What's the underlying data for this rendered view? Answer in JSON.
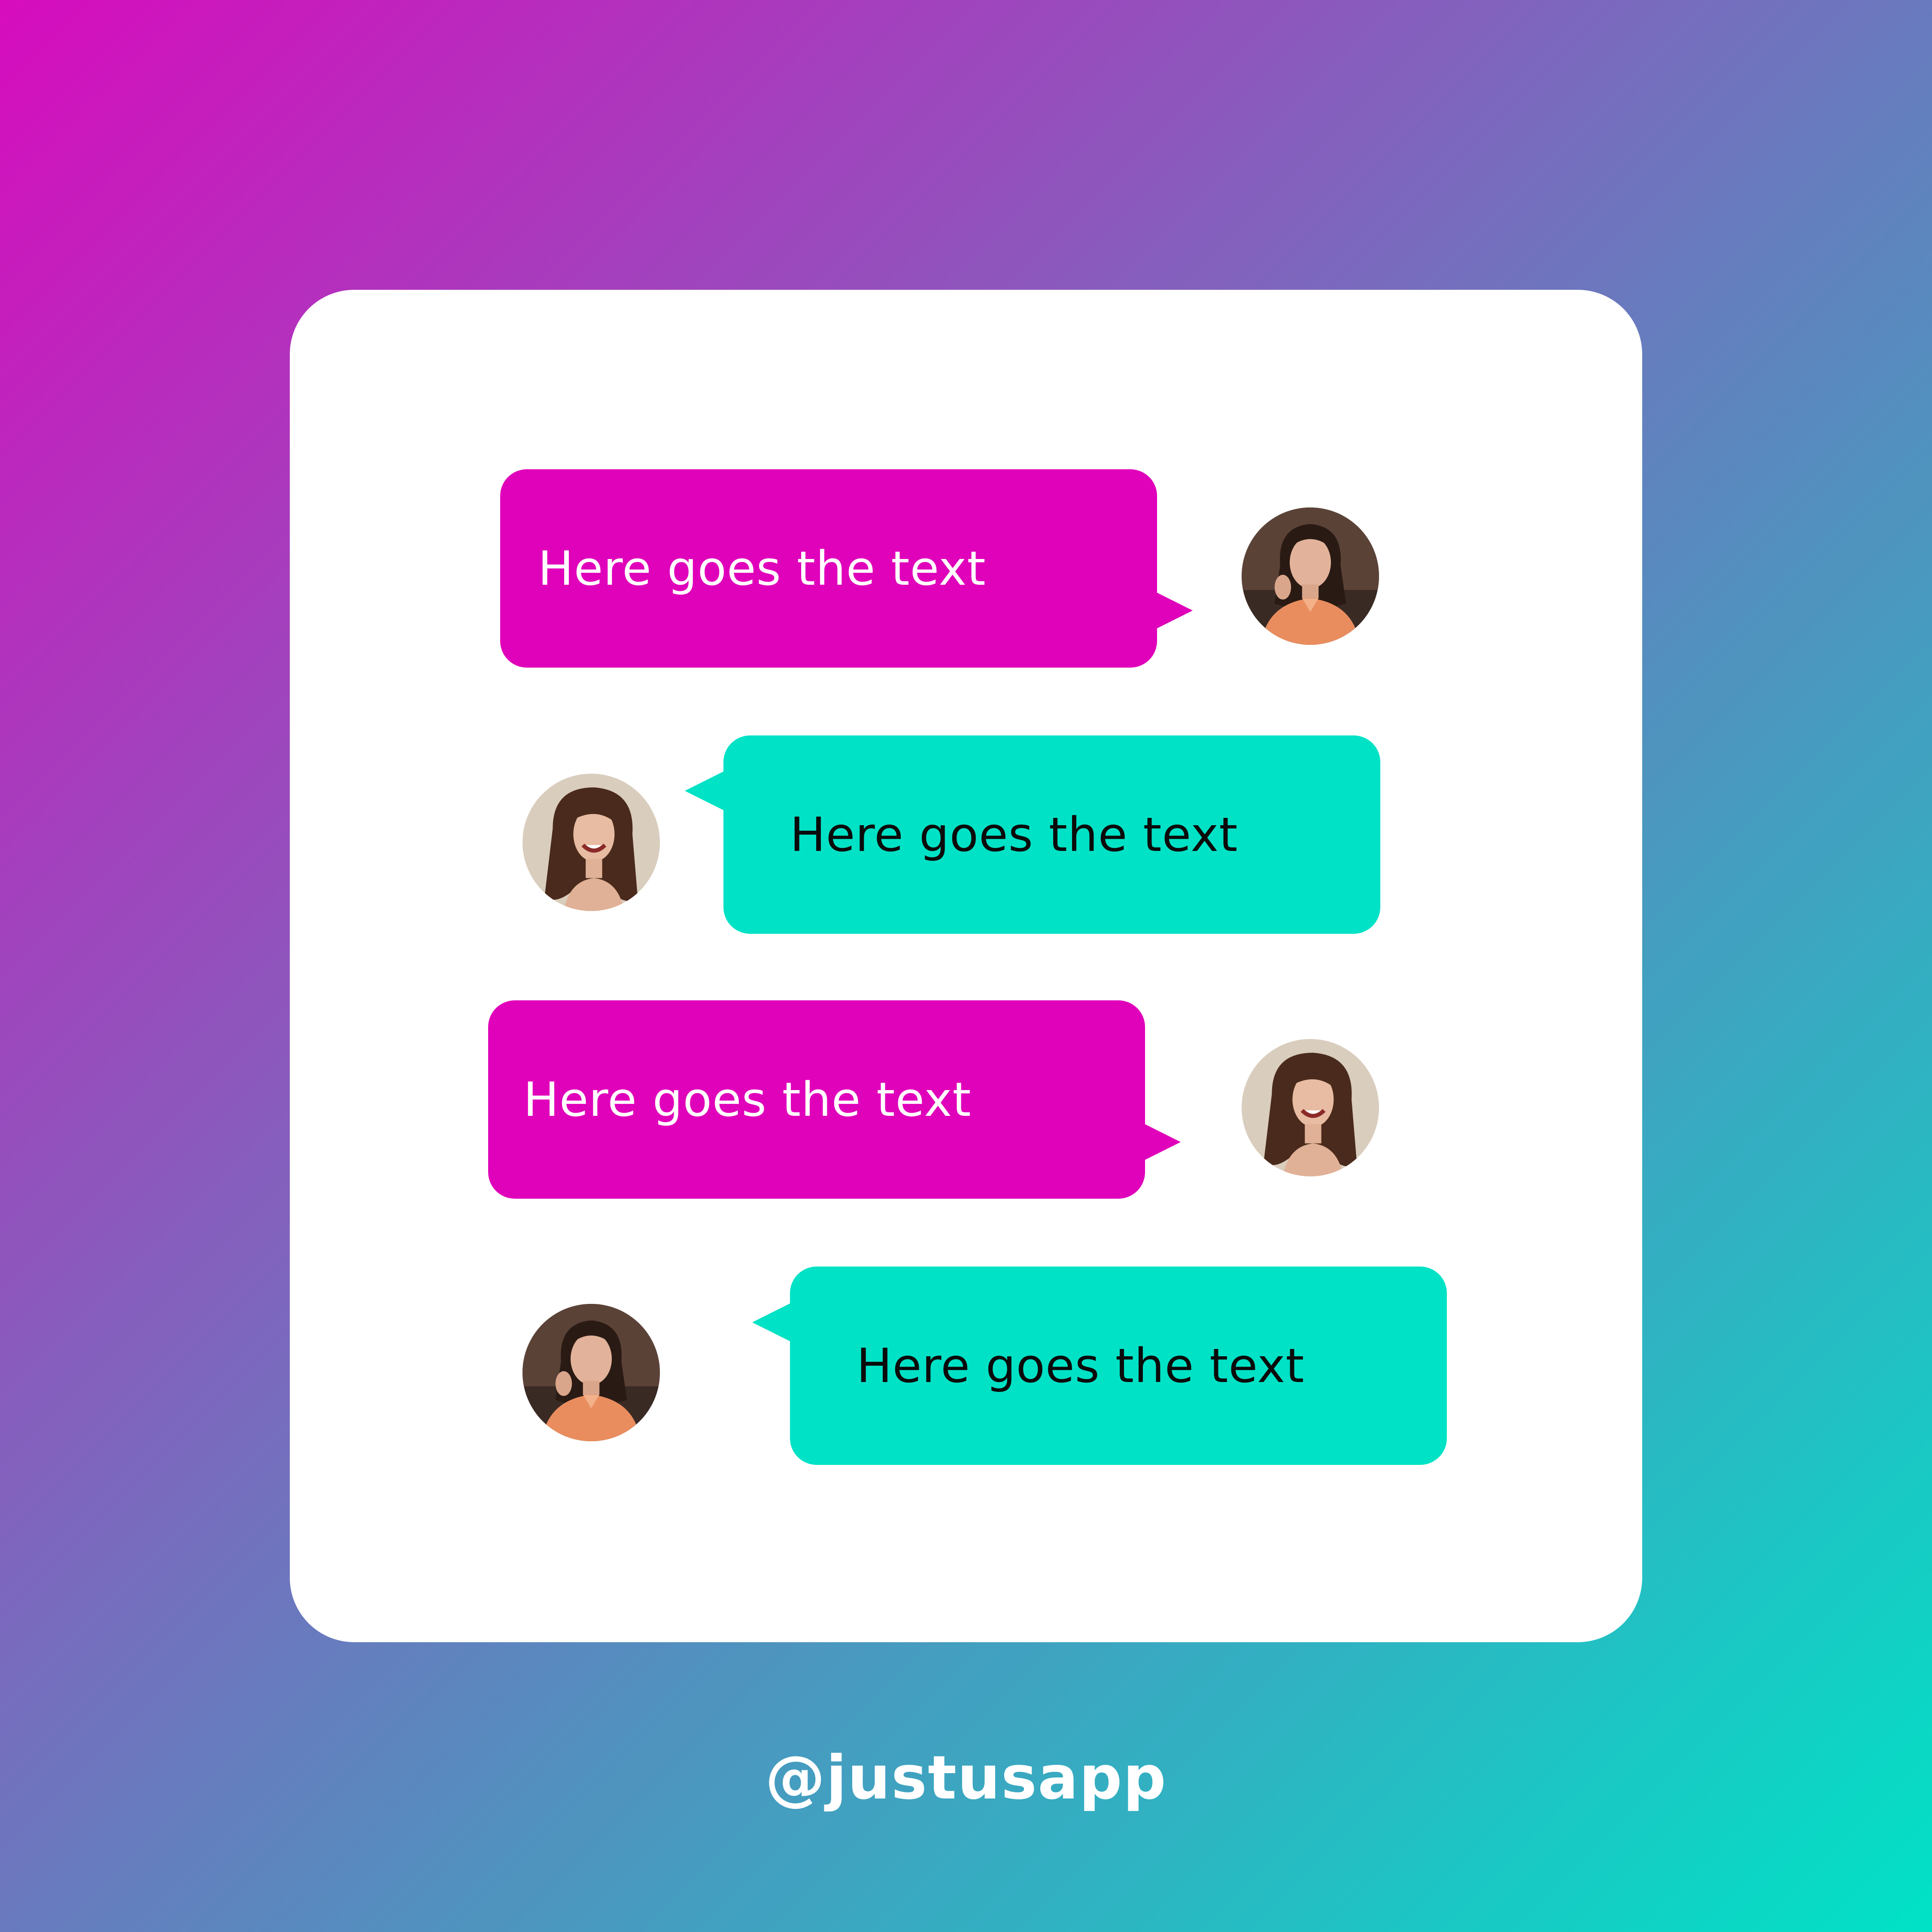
{
  "colors": {
    "magenta": "#e001ba",
    "teal": "#00e2c6",
    "card": "#ffffff"
  },
  "messages": [
    {
      "text": "Here goes the text",
      "color": "magenta",
      "avatar_side": "right",
      "avatar": "woman-orange-shirt-avatar"
    },
    {
      "text": "Here goes the text",
      "color": "teal",
      "avatar_side": "left",
      "avatar": "woman-smiling-avatar"
    },
    {
      "text": "Here goes the text",
      "color": "magenta",
      "avatar_side": "right",
      "avatar": "woman-smiling-avatar"
    },
    {
      "text": "Here goes the text",
      "color": "teal",
      "avatar_side": "left",
      "avatar": "woman-orange-shirt-avatar"
    }
  ],
  "footer": {
    "handle": "@justusapp"
  }
}
